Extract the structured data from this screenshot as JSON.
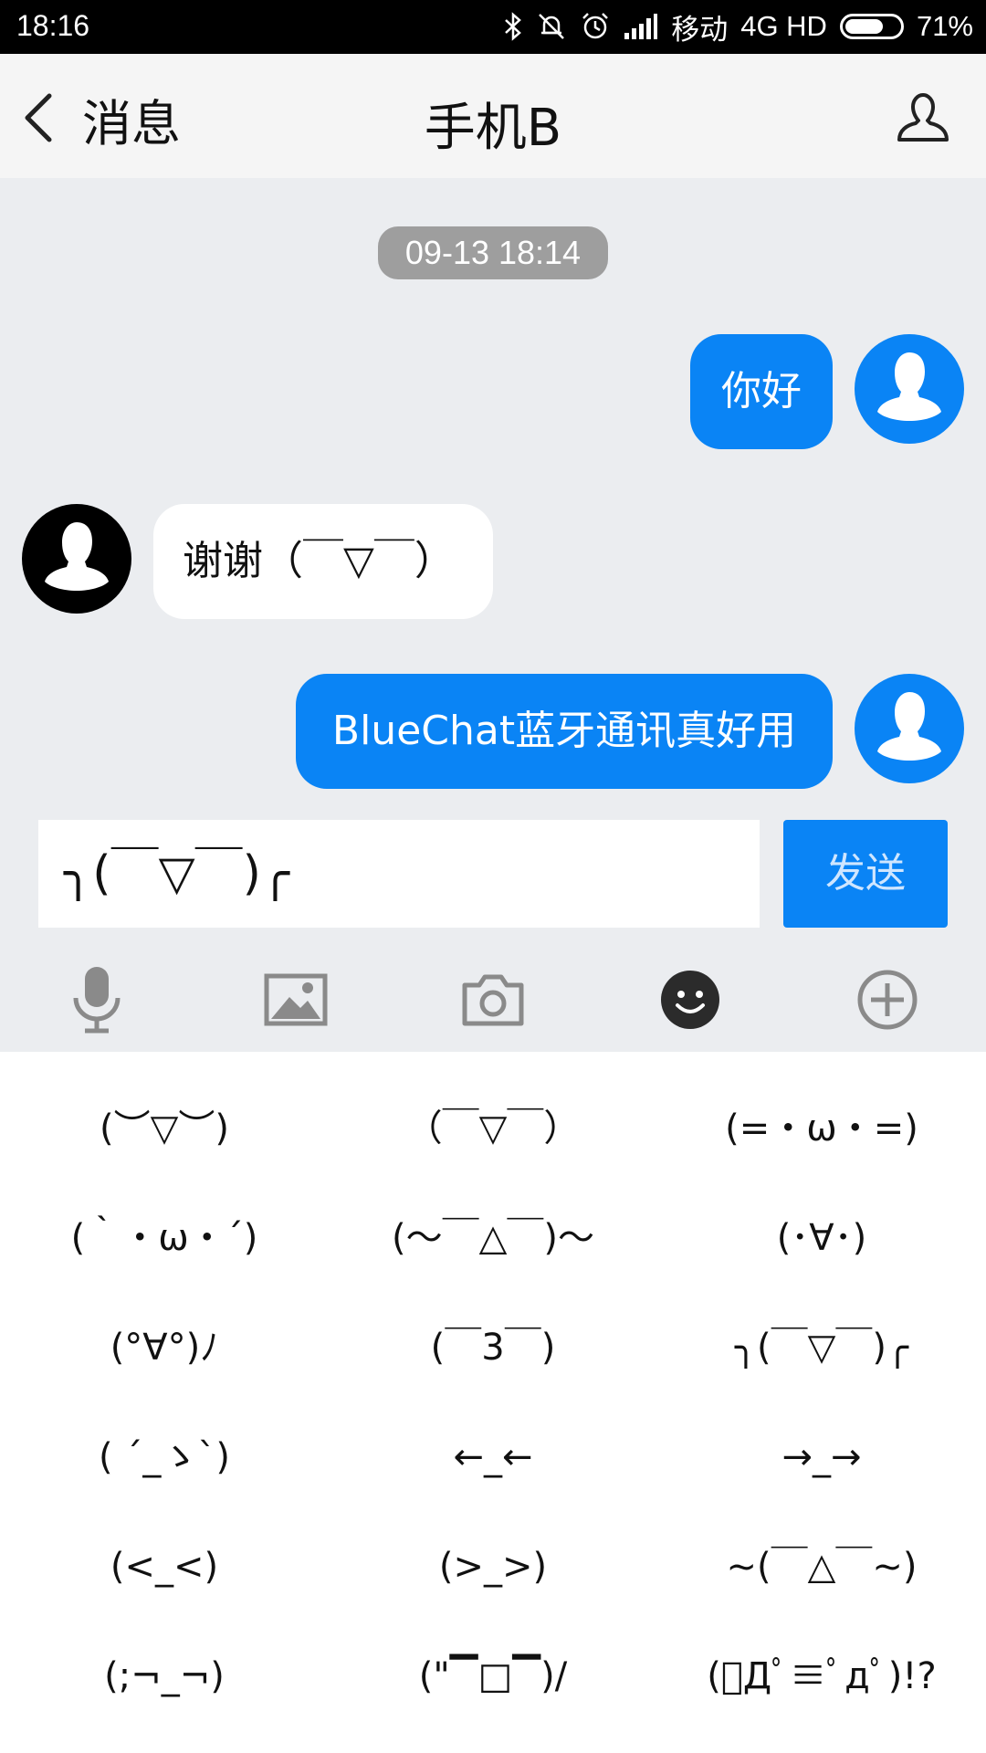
{
  "status_bar": {
    "time": "18:16",
    "carrier": "移动",
    "network": "4G HD",
    "battery_percent_label": "71%",
    "battery_level": 0.71,
    "icons": [
      "bluetooth-icon",
      "mute-icon",
      "alarm-icon",
      "signal-icon",
      "battery-icon"
    ]
  },
  "header": {
    "back_label": "消息",
    "title": "手机B",
    "icons": {
      "back": "chevron-left-icon",
      "contact": "person-icon"
    }
  },
  "chat": {
    "timestamp": "09-13 18:14",
    "messages": [
      {
        "side": "sent",
        "text": "你好"
      },
      {
        "side": "received",
        "text": "谢谢（￣▽￣）"
      },
      {
        "side": "sent",
        "text": "BlueChat蓝牙通讯真好用"
      }
    ]
  },
  "composer": {
    "input_value": "╮(￣▽￣)╭",
    "send_label": "发送"
  },
  "toolbar": {
    "tools": [
      "microphone-icon",
      "image-icon",
      "camera-icon",
      "emoji-icon",
      "add-icon"
    ]
  },
  "emoticons": [
    "(︶▽︶)",
    "（￣▽￣）",
    "(=・ω・=)",
    "(｀・ω・´)",
    "(〜￣△￣)〜",
    "(･∀･)",
    "(°∀°)ﾉ",
    "(￣3￣)",
    "╮(￣▽￣)╭",
    "( ´_ゝ`)",
    "←_←",
    "→_→",
    "(<_<)",
    "(>_>)",
    "~(￣△￣~)",
    "(;¬_¬)",
    "(\"▔□▔)/",
    "(ﾟДﾟ≡ﾟдﾟ)!?"
  ],
  "colors": {
    "accent": "#0a84f5",
    "chat_background": "#ebedf0",
    "timestamp_badge": "#9e9e9e"
  }
}
